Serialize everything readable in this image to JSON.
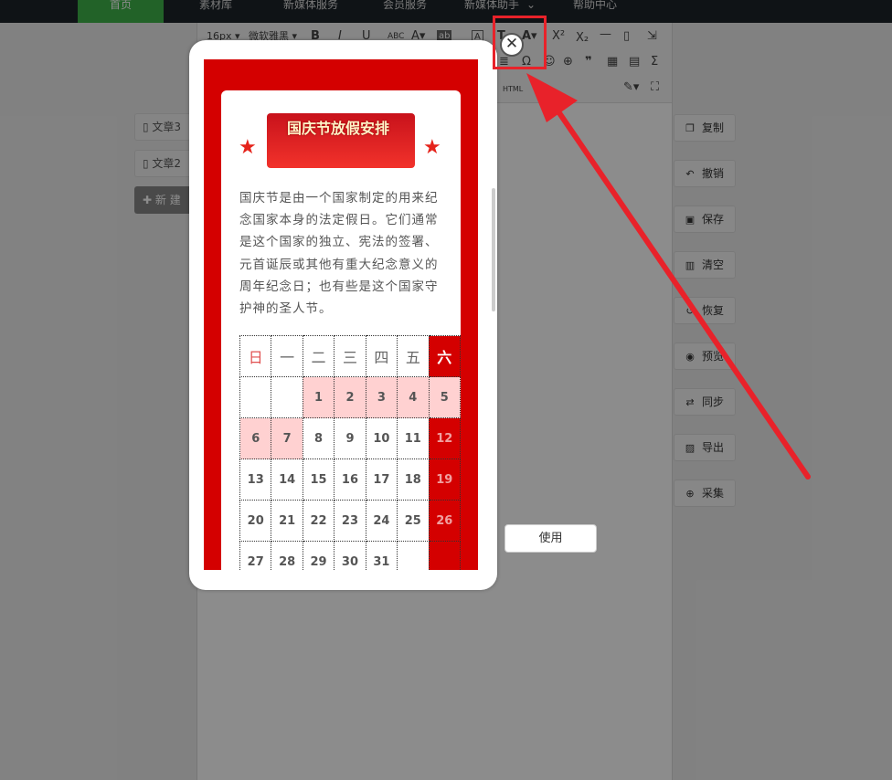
{
  "nav": [
    "首页",
    "素材库",
    "新媒体服务",
    "会员服务",
    "新媒体助手",
    "帮助中心"
  ],
  "articles": [
    "文章3",
    "文章2",
    "新 建"
  ],
  "toolbar": {
    "font_size": "16px",
    "font_family": "微软雅黑",
    "html": "HTML"
  },
  "actions": [
    {
      "label": "复制",
      "icon": "copy-icon"
    },
    {
      "label": "撤销",
      "icon": "undo-icon"
    },
    {
      "label": "保存",
      "icon": "save-icon"
    },
    {
      "label": "清空",
      "icon": "trash-icon"
    },
    {
      "label": "恢复",
      "icon": "restore-icon"
    },
    {
      "label": "预览",
      "icon": "eye-icon"
    },
    {
      "label": "同步",
      "icon": "sync-icon"
    },
    {
      "label": "导出",
      "icon": "image-export-icon"
    },
    {
      "label": "采集",
      "icon": "collect-icon"
    }
  ],
  "preview": {
    "title": "国庆节放假安排",
    "intro": "国庆节是由一个国家制定的用来纪念国家本身的法定假日。它们通常是这个国家的独立、宪法的签署、元首诞辰或其他有重大纪念意义的周年纪念日；也有些是这个国家守护神的圣人节。",
    "calendar": {
      "weekdays": [
        "日",
        "一",
        "二",
        "三",
        "四",
        "五",
        "六"
      ],
      "rows": [
        [
          "",
          "",
          "1",
          "2",
          "3",
          "4",
          "5"
        ],
        [
          "6",
          "7",
          "8",
          "9",
          "10",
          "11",
          "12"
        ],
        [
          "13",
          "14",
          "15",
          "16",
          "17",
          "18",
          "19"
        ],
        [
          "20",
          "21",
          "22",
          "23",
          "24",
          "25",
          "26"
        ],
        [
          "27",
          "28",
          "29",
          "30",
          "31",
          "",
          ""
        ]
      ],
      "holidays": [
        "1",
        "2",
        "3",
        "4",
        "5",
        "6",
        "7"
      ]
    }
  },
  "use_button": "使用",
  "colors": {
    "accent_red": "#d40000",
    "nav_green": "#3fb34a",
    "highlight": "#e8222a"
  }
}
